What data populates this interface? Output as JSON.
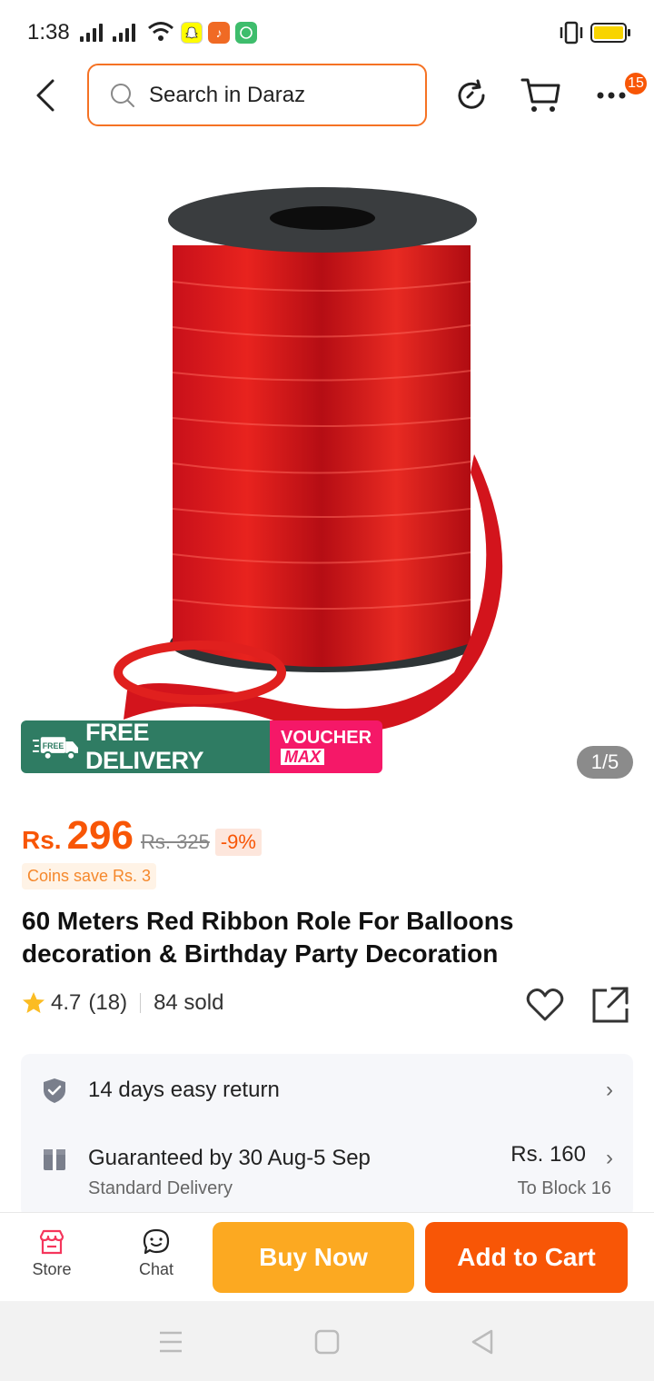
{
  "status_bar": {
    "time": "1:38",
    "app_icons": [
      "snapchat-icon",
      "tiktok-icon",
      "whatsapp-icon"
    ]
  },
  "nav": {
    "search_placeholder": "Search in Daraz",
    "cart_badge": "15"
  },
  "gallery": {
    "counter": "1/5",
    "delivery_label": "FREE DELIVERY",
    "truck_label": "FREE",
    "voucher_line1": "VOUCHER",
    "voucher_line2": "MAX"
  },
  "price": {
    "currency": "Rs.",
    "current": "296",
    "original": "Rs. 325",
    "discount": "-9%",
    "coins_save": "Coins save Rs. 3"
  },
  "product": {
    "title": "60 Meters Red Ribbon Role For Balloons decoration & Birthday Party Decoration",
    "rating": "4.7",
    "reviews": "(18)",
    "sold": "84 sold"
  },
  "services": {
    "return_text": "14 days easy return",
    "delivery_text": "Guaranteed by 30 Aug-5 Sep",
    "delivery_price": "Rs. 160",
    "delivery_type": "Standard Delivery",
    "delivery_to": "To Block 16"
  },
  "bottom_bar": {
    "store_label": "Store",
    "chat_label": "Chat",
    "buy_now": "Buy Now",
    "add_to_cart": "Add to Cart"
  },
  "colors": {
    "accent": "#f85606",
    "buy_now": "#fca921",
    "delivery_green": "#2f7c63",
    "voucher_pink": "#f51868"
  }
}
